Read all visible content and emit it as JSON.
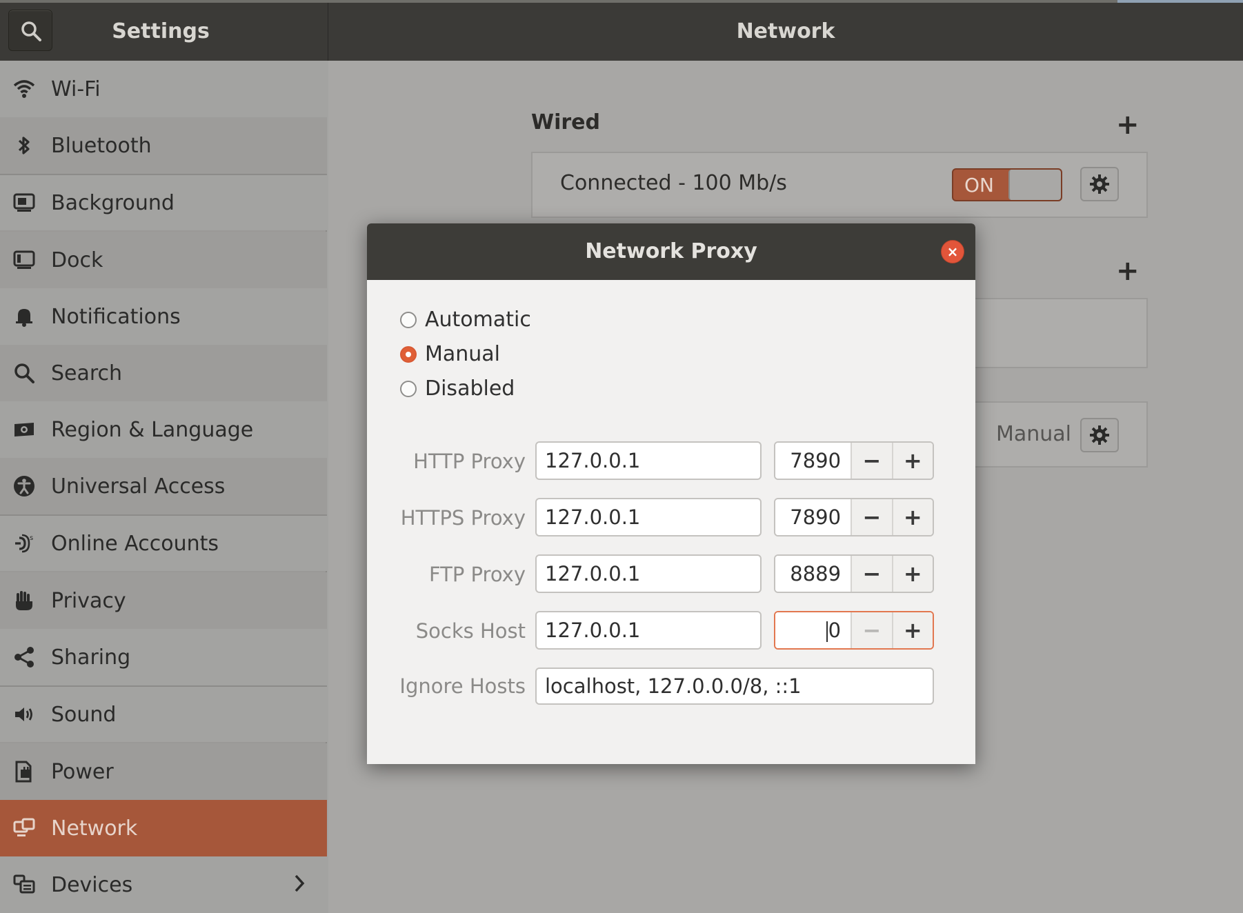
{
  "header": {
    "settings_title": "Settings",
    "main_title": "Network"
  },
  "sidebar": {
    "items": [
      {
        "label": "Wi-Fi",
        "icon": "wifi-icon"
      },
      {
        "label": "Bluetooth",
        "icon": "bluetooth-icon"
      },
      {
        "label": "Background",
        "icon": "background-icon"
      },
      {
        "label": "Dock",
        "icon": "dock-icon"
      },
      {
        "label": "Notifications",
        "icon": "bell-icon"
      },
      {
        "label": "Search",
        "icon": "search-icon"
      },
      {
        "label": "Region & Language",
        "icon": "region-icon"
      },
      {
        "label": "Universal Access",
        "icon": "accessibility-icon"
      },
      {
        "label": "Online Accounts",
        "icon": "online-accounts-icon"
      },
      {
        "label": "Privacy",
        "icon": "privacy-hand-icon"
      },
      {
        "label": "Sharing",
        "icon": "share-icon"
      },
      {
        "label": "Sound",
        "icon": "speaker-icon"
      },
      {
        "label": "Power",
        "icon": "power-icon"
      },
      {
        "label": "Network",
        "icon": "network-icon",
        "active": true
      },
      {
        "label": "Devices",
        "icon": "devices-icon"
      }
    ]
  },
  "main": {
    "wired_title": "Wired",
    "wired_status": "Connected - 100 Mb/s",
    "toggle_label": "ON",
    "proxy_mode": "Manual",
    "add_symbol": "+"
  },
  "dialog": {
    "title": "Network Proxy",
    "close_symbol": "×",
    "modes": [
      "Automatic",
      "Manual",
      "Disabled"
    ],
    "selected_mode": "Manual",
    "proxies": [
      {
        "label": "HTTP Proxy",
        "host": "127.0.0.1",
        "port": "7890"
      },
      {
        "label": "HTTPS Proxy",
        "host": "127.0.0.1",
        "port": "7890"
      },
      {
        "label": "FTP Proxy",
        "host": "127.0.0.1",
        "port": "8889"
      },
      {
        "label": "Socks Host",
        "host": "127.0.0.1",
        "port": "0"
      }
    ],
    "ignore_hosts_label": "Ignore Hosts",
    "ignore_hosts_value": "localhost, 127.0.0.0/8, ::1",
    "minus_symbol": "−",
    "plus_symbol": "+"
  },
  "colors": {
    "accent": "#e05f36",
    "header": "#3b3a37",
    "active_sidebar": "#a6573a"
  }
}
